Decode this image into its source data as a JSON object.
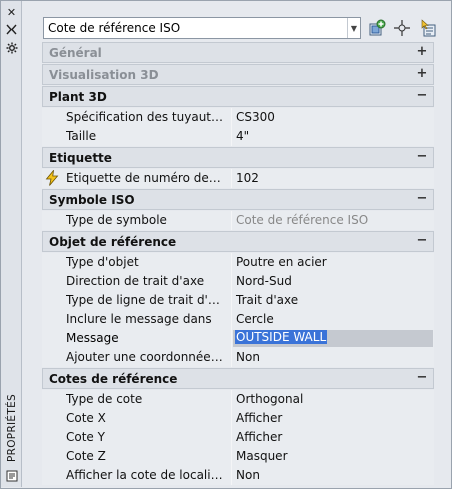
{
  "palette": {
    "title": "PROPRIÉTÉS"
  },
  "selector": {
    "value": "Cote de référence ISO"
  },
  "toolbar": {
    "icons": [
      "quick-select-icon",
      "select-objects-icon",
      "toggle-pickadd-icon"
    ]
  },
  "categories": [
    {
      "title": "Général",
      "collapsed": true,
      "toggle": "+",
      "rows": []
    },
    {
      "title": "Visualisation 3D",
      "collapsed": true,
      "toggle": "+",
      "rows": []
    },
    {
      "title": "Plant 3D",
      "collapsed": false,
      "toggle": "−",
      "rows": [
        {
          "label": "Spécification des tuyauteries",
          "value": "CS300"
        },
        {
          "label": "Taille",
          "value": "4\""
        }
      ]
    },
    {
      "title": "Etiquette",
      "collapsed": false,
      "toggle": "−",
      "rows": [
        {
          "label": "Etiquette de numéro de ligne",
          "value": "102",
          "icon": "lightning-icon"
        }
      ]
    },
    {
      "title": "Symbole ISO",
      "collapsed": false,
      "toggle": "−",
      "rows": [
        {
          "label": "Type de symbole",
          "value": "Cote de référence ISO",
          "readonly": true
        }
      ]
    },
    {
      "title": "Objet de référence",
      "collapsed": false,
      "toggle": "−",
      "rows": [
        {
          "label": "Type d'objet",
          "value": "Poutre en acier"
        },
        {
          "label": "Direction de trait d'axe",
          "value": "Nord-Sud"
        },
        {
          "label": "Type de ligne de trait d'axe",
          "value": "Trait d'axe"
        },
        {
          "label": "Inclure le message dans",
          "value": "Cercle"
        },
        {
          "label": "Message",
          "value": "OUTSIDE WALL",
          "editing": true
        },
        {
          "label": "Ajouter une coordonnée au...",
          "value": "Non"
        }
      ]
    },
    {
      "title": "Cotes de référence",
      "collapsed": false,
      "toggle": "−",
      "rows": [
        {
          "label": "Type de cote",
          "value": "Orthogonal"
        },
        {
          "label": "Cote X",
          "value": "Afficher"
        },
        {
          "label": "Cote Y",
          "value": "Afficher"
        },
        {
          "label": "Cote Z",
          "value": "Masquer"
        },
        {
          "label": "Afficher la cote de localisation",
          "value": "Non"
        }
      ]
    }
  ],
  "colors": {
    "accent": "#3a73d8",
    "category_bg": "#dde1e7",
    "row_bg": "#e9ecf0"
  }
}
